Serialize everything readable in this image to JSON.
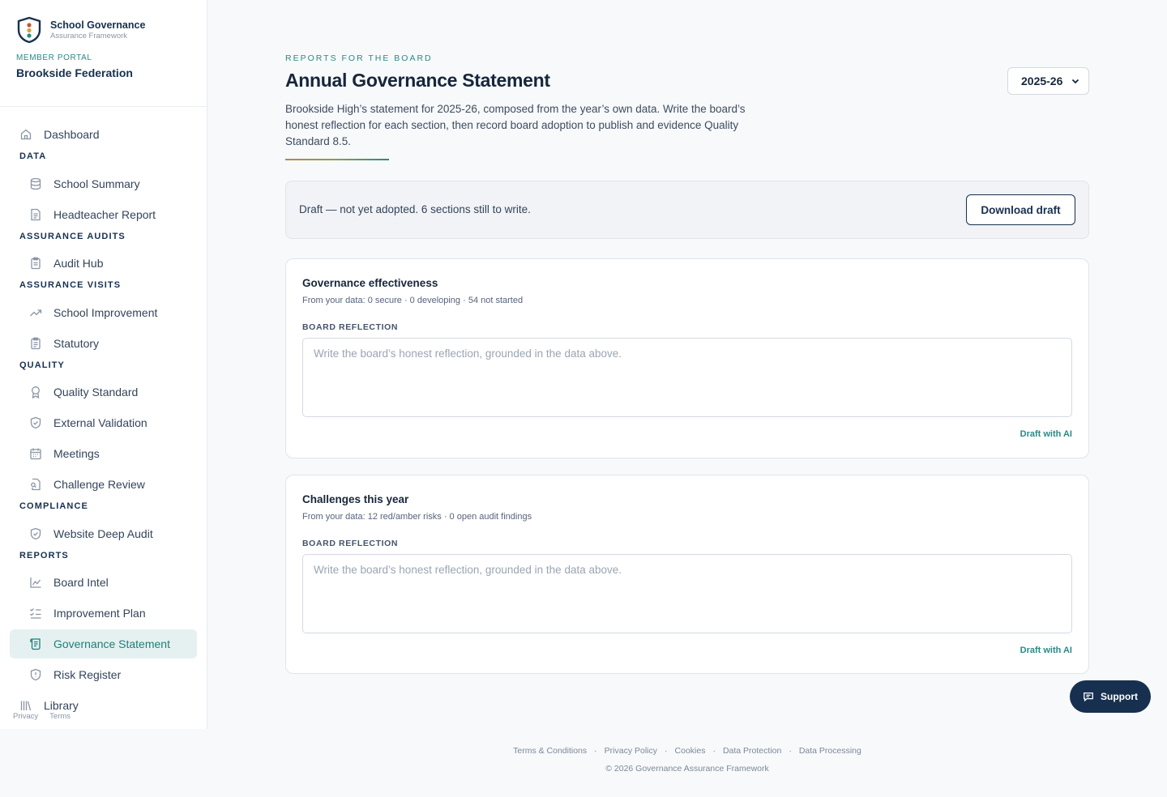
{
  "brand": {
    "name": "School Governance",
    "subtitle": "Assurance Framework"
  },
  "portal": {
    "label": "MEMBER PORTAL",
    "org": "Brookside Federation"
  },
  "nav": {
    "dashboard": "Dashboard",
    "sections": {
      "data": "DATA",
      "audits": "ASSURANCE AUDITS",
      "visits": "ASSURANCE VISITS",
      "quality": "QUALITY",
      "compliance": "COMPLIANCE",
      "reports": "REPORTS"
    },
    "items": {
      "school_summary": "School Summary",
      "headteacher_report": "Headteacher Report",
      "audit_hub": "Audit Hub",
      "school_improvement": "School Improvement",
      "statutory": "Statutory",
      "quality_standard": "Quality Standard",
      "external_validation": "External Validation",
      "meetings": "Meetings",
      "challenge_review": "Challenge Review",
      "website_deep_audit": "Website Deep Audit",
      "board_intel": "Board Intel",
      "improvement_plan": "Improvement Plan",
      "governance_statement": "Governance Statement",
      "risk_register": "Risk Register",
      "library": "Library"
    },
    "active": "governance_statement"
  },
  "sidebar_footer": {
    "privacy": "Privacy",
    "terms": "Terms"
  },
  "header": {
    "eyebrow": "REPORTS FOR THE BOARD",
    "title": "Annual Governance Statement",
    "description": "Brookside High’s statement for 2025-26, composed from the year’s own data. Write the board’s honest reflection for each section, then record board adoption to publish and evidence Quality Standard 8.5."
  },
  "year_select": {
    "selected": "2025-26"
  },
  "status": {
    "text": "Draft — not yet adopted. 6 sections still to write.",
    "download_label": "Download draft"
  },
  "sections": [
    {
      "title": "Governance effectiveness",
      "data_line": "From your data: 0 secure · 0 developing · 54 not started",
      "label": "BOARD REFLECTION",
      "placeholder": "Write the board’s honest reflection, grounded in the data above.",
      "value": "",
      "ai_label": "Draft with AI"
    },
    {
      "title": "Challenges this year",
      "data_line": "From your data: 12 red/amber risks · 0 open audit findings",
      "label": "BOARD REFLECTION",
      "placeholder": "Write the board’s honest reflection, grounded in the data above.",
      "value": "",
      "ai_label": "Draft with AI"
    }
  ],
  "support": {
    "label": "Support"
  },
  "footer": {
    "links": [
      "Terms & Conditions",
      "Privacy Policy",
      "Cookies",
      "Data Protection",
      "Data Processing"
    ],
    "copyright": "© 2026 Governance Assurance Framework"
  },
  "colors": {
    "accent": "#2a8a87",
    "navy": "#17304f",
    "active_bg": "#e5f1f0"
  }
}
